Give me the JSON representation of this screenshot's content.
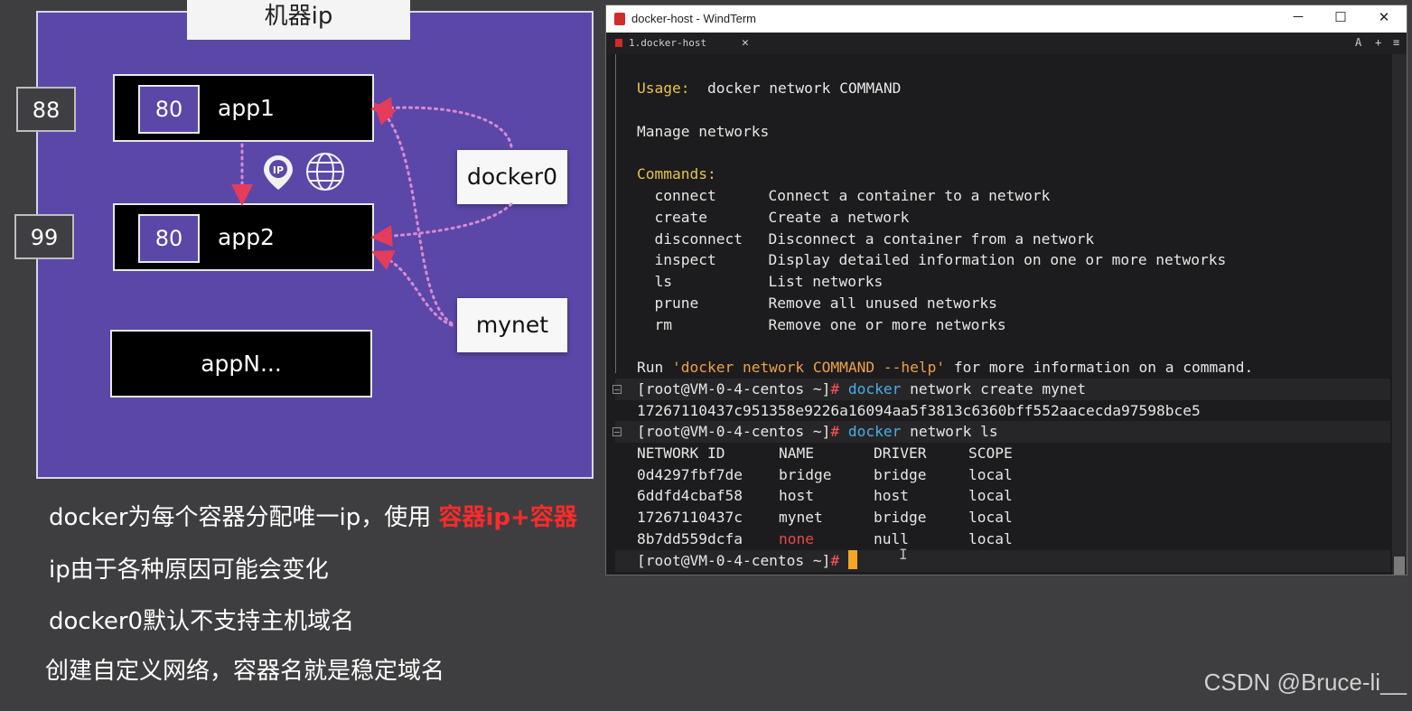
{
  "slide": {
    "title": "机器ip",
    "host_ports": [
      "88",
      "99"
    ],
    "apps": [
      {
        "port": "80",
        "name": "app1"
      },
      {
        "port": "80",
        "name": "app2"
      },
      {
        "name": "appN..."
      }
    ],
    "networks": [
      "docker0",
      "mynet"
    ],
    "icons": [
      "ip-pin-icon",
      "globe-www-icon"
    ],
    "notes": [
      {
        "text": "docker为每个容器分配唯一ip，使用 ",
        "highlight": "容器ip+容器"
      },
      {
        "text": "ip由于各种原因可能会变化"
      },
      {
        "text": "docker0默认不支持主机域名"
      },
      {
        "text": "创建自定义网络，容器名就是稳定域名"
      }
    ],
    "colors": {
      "panel": "#5b47a8",
      "highlight": "#ff2a2a",
      "arrow": "#e43c5a"
    }
  },
  "watermark": "CSDN @Bruce-li__",
  "terminal": {
    "window_title": "docker-host - WindTerm",
    "tab_label": "1.docker-host",
    "controls": {
      "minimize": "─",
      "maximize": "☐",
      "close": "✕"
    },
    "tab_tools": {
      "font": "A",
      "add": "+",
      "menu": "≡"
    },
    "usage": {
      "label": "Usage:",
      "command": "  docker network COMMAND"
    },
    "manage": "Manage networks",
    "commands_label": "Commands:",
    "commands": [
      {
        "name": "connect",
        "desc": "Connect a container to a network"
      },
      {
        "name": "create",
        "desc": "Create a network"
      },
      {
        "name": "disconnect",
        "desc": "Disconnect a container from a network"
      },
      {
        "name": "inspect",
        "desc": "Display detailed information on one or more networks"
      },
      {
        "name": "ls",
        "desc": "List networks"
      },
      {
        "name": "prune",
        "desc": "Remove all unused networks"
      },
      {
        "name": "rm",
        "desc": "Remove one or more networks"
      }
    ],
    "run_hint": {
      "pre": "Run ",
      "quoted": "'docker network COMMAND --help'",
      "post": " for more information on a command."
    },
    "prompt": "[root@VM-0-4-centos ~]",
    "hash": "#",
    "cmd1": {
      "docker": "docker",
      "rest": " network create mynet"
    },
    "network_id_output": "17267110437c951358e9226a16094aa5f3813c6360bff552aacecda97598bce5",
    "cmd2": {
      "docker": "docker",
      "rest": " network ls"
    },
    "table": {
      "headers": [
        "NETWORK ID",
        "NAME",
        "DRIVER",
        "SCOPE"
      ],
      "rows": [
        [
          "0d4297fbf7de",
          "bridge",
          "bridge",
          "local"
        ],
        [
          "6ddfd4cbaf58",
          "host",
          "host",
          "local"
        ],
        [
          "17267110437c",
          "mynet",
          "bridge",
          "local"
        ],
        [
          "8b7dd559dcfa",
          "none",
          "null",
          "local"
        ]
      ]
    },
    "ibeam": "I",
    "colors": {
      "keyword": "#e8c44a",
      "string": "#f0a04a",
      "command": "#4aaee8",
      "none": "#e84a4a",
      "cursor": "#f5a623"
    }
  }
}
